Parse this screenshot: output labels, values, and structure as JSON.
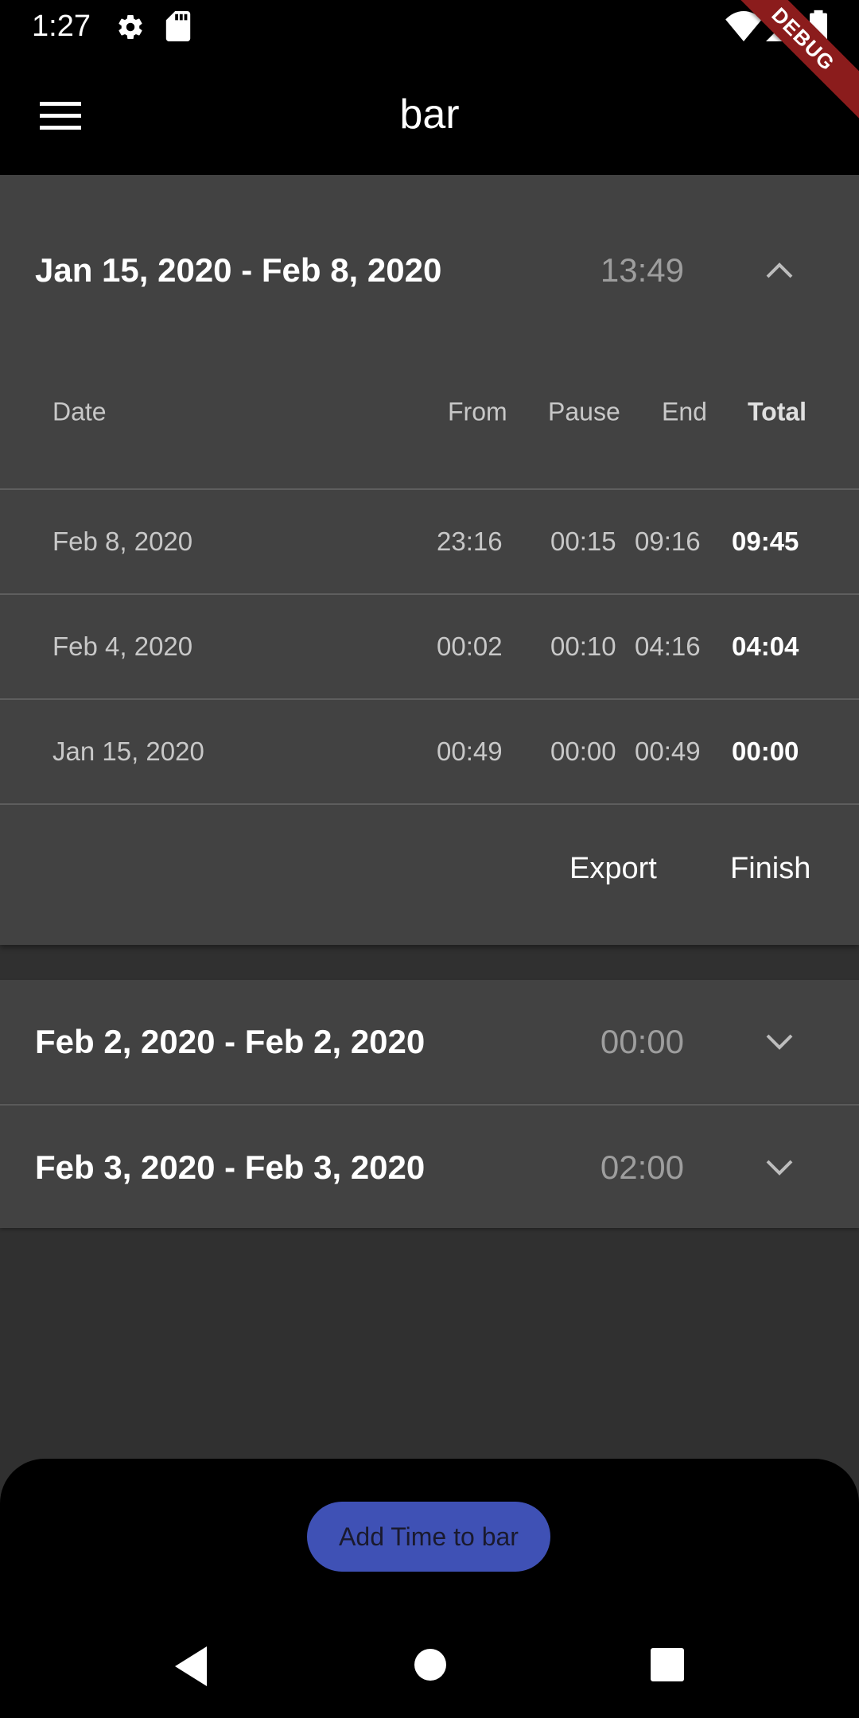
{
  "status_bar": {
    "time": "1:27",
    "debug_label": "DEBUG",
    "icons": [
      "gear-icon",
      "sd-card-icon",
      "wifi-icon",
      "signal-icon",
      "battery-icon"
    ]
  },
  "app_bar": {
    "title": "bar",
    "menu_icon": "hamburger-menu-icon"
  },
  "periods": [
    {
      "range": "Jan 15, 2020 - Feb 8, 2020",
      "total": "13:49",
      "expanded": true,
      "columns": {
        "date": "Date",
        "from": "From",
        "pause": "Pause",
        "end": "End",
        "total": "Total"
      },
      "rows": [
        {
          "date": "Feb 8, 2020",
          "from": "23:16",
          "pause": "00:15",
          "end": "09:16",
          "total": "09:45"
        },
        {
          "date": "Feb 4, 2020",
          "from": "00:02",
          "pause": "00:10",
          "end": "04:16",
          "total": "04:04"
        },
        {
          "date": "Jan 15, 2020",
          "from": "00:49",
          "pause": "00:00",
          "end": "00:49",
          "total": "00:00"
        }
      ],
      "actions": {
        "export": "Export",
        "finish": "Finish"
      }
    },
    {
      "range": "Feb 2, 2020 - Feb 2, 2020",
      "total": "00:00",
      "expanded": false
    },
    {
      "range": "Feb 3, 2020 - Feb 3, 2020",
      "total": "02:00",
      "expanded": false
    }
  ],
  "fab": {
    "label": "Add Time to bar"
  },
  "colors": {
    "background": "#303030",
    "panel": "#424242",
    "appbar": "#000000",
    "fab": "#3f51b5",
    "debug": "#8b1c1c"
  }
}
